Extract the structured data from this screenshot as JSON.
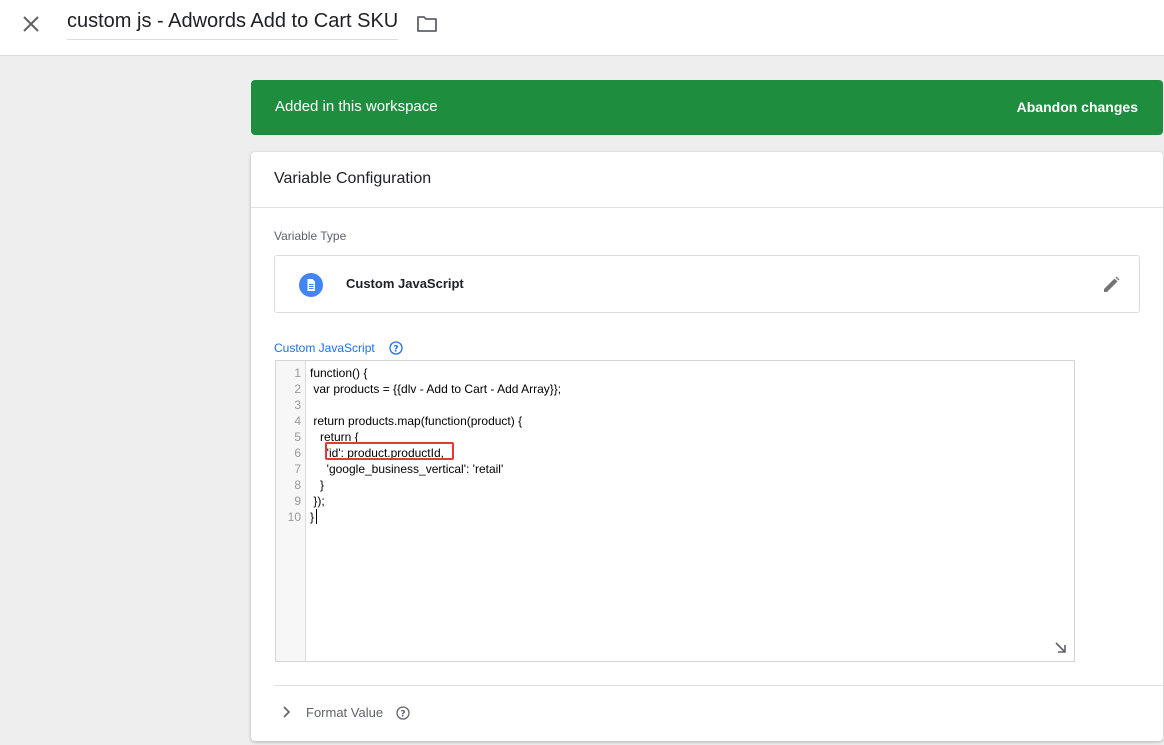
{
  "header": {
    "title": "custom js - Adwords Add to Cart SKU",
    "close_icon": "close-icon",
    "folder_icon": "folder-icon"
  },
  "banner": {
    "text": "Added in this workspace",
    "action": "Abandon changes",
    "color": "#1e8e3e"
  },
  "card": {
    "title": "Variable Configuration",
    "variable_type_label": "Variable Type",
    "variable_type": "Custom JavaScript",
    "variable_type_icon": "document-icon",
    "edit_icon": "pencil-icon",
    "custom_js_label": "Custom JavaScript",
    "format_value_label": "Format Value"
  },
  "editor": {
    "line_numbers": [
      "1",
      "2",
      "3",
      "4",
      "5",
      "6",
      "7",
      "8",
      "9",
      "10"
    ],
    "code_lines": [
      "function() {",
      " var products = {{dlv - Add to Cart - Add Array}};",
      "",
      " return products.map(function(product) {",
      "   return {",
      "     'id': product.productId,",
      "     'google_business_vertical': 'retail'",
      "   }",
      " });",
      "}"
    ],
    "highlighted_line": 6,
    "highlight_color": "#e53935"
  }
}
